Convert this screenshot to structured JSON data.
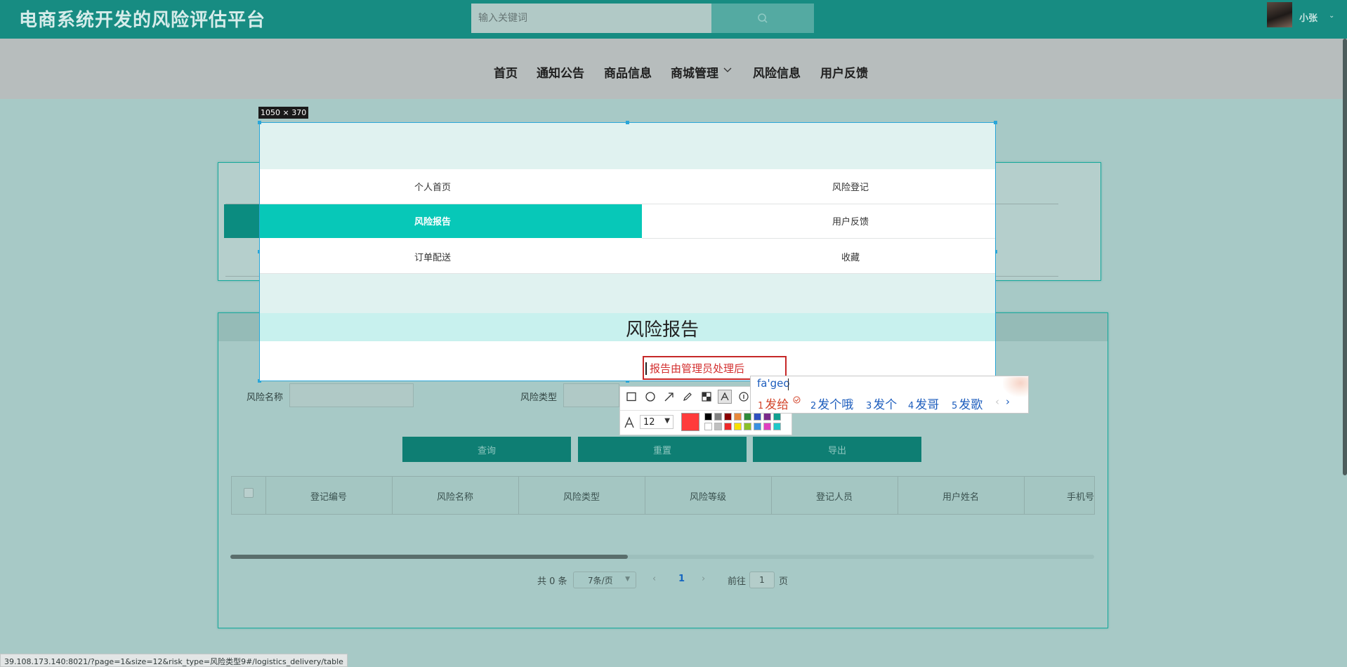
{
  "header": {
    "site_title": "电商系统开发的风险评估平台",
    "search_placeholder": "输入关键词",
    "user_name": "小张",
    "user_caret": "⌄"
  },
  "nav": {
    "items": [
      "首页",
      "通知公告",
      "商品信息",
      "商城管理",
      "风险信息",
      "用户反馈"
    ],
    "dropdown_item_index": 3
  },
  "capture": {
    "size_label": "1050 × 370"
  },
  "side_menu": {
    "items": [
      {
        "label": "个人首页",
        "active": false
      },
      {
        "label": "风险登记",
        "active": false
      },
      {
        "label": "风险报告",
        "active": true
      },
      {
        "label": "用户反馈",
        "active": false
      },
      {
        "label": "订单配送",
        "active": false
      },
      {
        "label": "收藏",
        "active": false
      }
    ]
  },
  "report": {
    "page_title": "风险报告",
    "annotation_text": "报告由管理员处理后"
  },
  "search_form": {
    "fields": [
      {
        "label": "风险名称",
        "value": ""
      },
      {
        "label": "风险类型",
        "value": ""
      }
    ],
    "buttons": [
      "查询",
      "重置",
      "导出"
    ]
  },
  "table": {
    "columns": [
      "登记编号",
      "风险名称",
      "风险类型",
      "风险等级",
      "登记人员",
      "用户姓名",
      "手机号"
    ],
    "rows": []
  },
  "pagination": {
    "total_text": "共 0 条",
    "page_size": "7条/页",
    "prev": "‹",
    "current_page": "1",
    "next": "›",
    "goto_label": "前往",
    "goto_value": "1",
    "page_suffix": "页"
  },
  "draw_toolbar": {
    "tools": [
      "rectangle-tool",
      "ellipse-tool",
      "arrow-tool",
      "pen-tool",
      "mosaic-tool",
      "text-tool",
      "number-tool"
    ],
    "active_tool": "text-tool",
    "font_size": "12",
    "current_color": "#ff3b3b",
    "palette_row1": [
      "#000000",
      "#808080",
      "#8b0000",
      "#e8893a",
      "#2e8b3a",
      "#3050c0",
      "#7a2a8a",
      "#10a090"
    ],
    "palette_row2": [
      "#ffffff",
      "#c0c0c0",
      "#ee2a2a",
      "#f7e000",
      "#8ac02a",
      "#3a90e0",
      "#e040c0",
      "#20c8c8"
    ]
  },
  "ime": {
    "input": "fa'geo",
    "candidates": [
      {
        "num": "1",
        "text": "发给"
      },
      {
        "num": "2",
        "text": "发个哦"
      },
      {
        "num": "3",
        "text": "发个"
      },
      {
        "num": "4",
        "text": "发哥"
      },
      {
        "num": "5",
        "text": "发歌"
      }
    ],
    "prev": "‹",
    "next": "›"
  },
  "status_bar": {
    "url": "39.108.173.140:8021/?page=1&size=12&risk_type=风险类型9#/logistics_delivery/table"
  }
}
